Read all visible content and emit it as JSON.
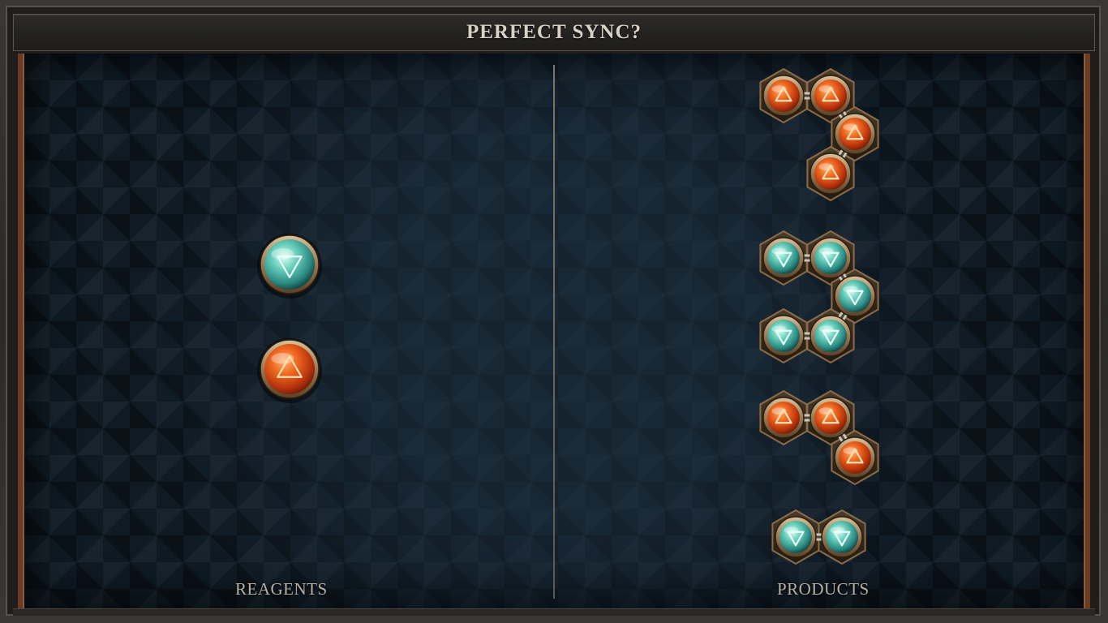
{
  "header": {
    "title": "PERFECT SYNC?"
  },
  "labels": {
    "reagents": "REAGENTS",
    "products": "PRODUCTS"
  },
  "colors": {
    "frame": "#2a2926",
    "board": "#0f1a23",
    "accent_wood": "#6a3c24",
    "fire_orb": "#e0541c",
    "water_orb": "#3fb0a0",
    "bronze": "#a08058"
  },
  "icons": {
    "fire": "fire-triangle-up-icon",
    "water": "water-triangle-down-icon"
  },
  "reagents": [
    {
      "element": "water"
    },
    {
      "element": "fire"
    }
  ],
  "products": [
    {
      "shape": "chain-4",
      "elements": [
        "fire",
        "fire",
        "fire",
        "fire"
      ]
    },
    {
      "shape": "chain-5",
      "elements": [
        "water",
        "water",
        "water",
        "water",
        "water"
      ]
    },
    {
      "shape": "chain-3",
      "elements": [
        "fire",
        "fire",
        "fire"
      ]
    },
    {
      "shape": "pair",
      "elements": [
        "water",
        "water"
      ]
    }
  ]
}
